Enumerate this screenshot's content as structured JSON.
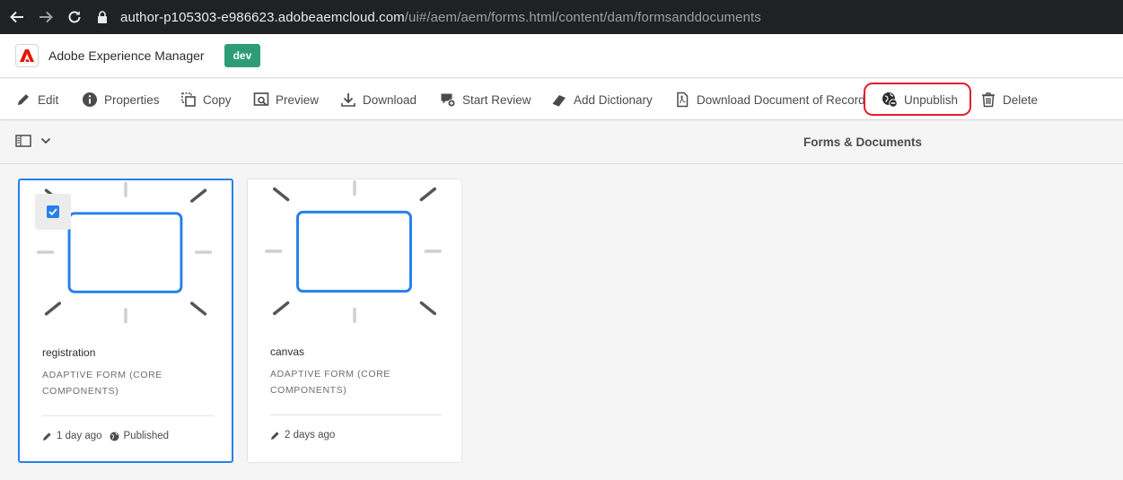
{
  "browser": {
    "url_host": "author-p105303-e986623.adobeaemcloud.com",
    "url_path": "/ui#/aem/aem/forms.html/content/dam/formsanddocuments"
  },
  "header": {
    "app_title": "Adobe Experience Manager",
    "env_badge": "dev",
    "brand_color": "#eb1000",
    "badge_color": "#2d9d78"
  },
  "actions": [
    {
      "label": "Edit",
      "icon": "pencil-icon"
    },
    {
      "label": "Properties",
      "icon": "info-icon"
    },
    {
      "label": "Copy",
      "icon": "copy-icon"
    },
    {
      "label": "Preview",
      "icon": "preview-icon"
    },
    {
      "label": "Download",
      "icon": "download-icon"
    },
    {
      "label": "Start Review",
      "icon": "review-icon"
    },
    {
      "label": "Add Dictionary",
      "icon": "dictionary-icon"
    },
    {
      "label": "Download Document of Record",
      "icon": "document-icon"
    },
    {
      "label": "Unpublish",
      "icon": "unpublish-icon",
      "highlighted": true
    },
    {
      "label": "Delete",
      "icon": "trash-icon"
    }
  ],
  "subheader": {
    "title": "Forms & Documents"
  },
  "cards": [
    {
      "title": "registration",
      "type": "ADAPTIVE FORM (CORE COMPONENTS)",
      "modified": "1 day ago",
      "status": "Published",
      "selected": true
    },
    {
      "title": "canvas",
      "type": "ADAPTIVE FORM (CORE COMPONENTS)",
      "modified": "2 days ago",
      "status": "",
      "selected": false
    }
  ],
  "colors": {
    "selection_accent": "#2680eb",
    "highlight_ring": "#e0202d"
  }
}
